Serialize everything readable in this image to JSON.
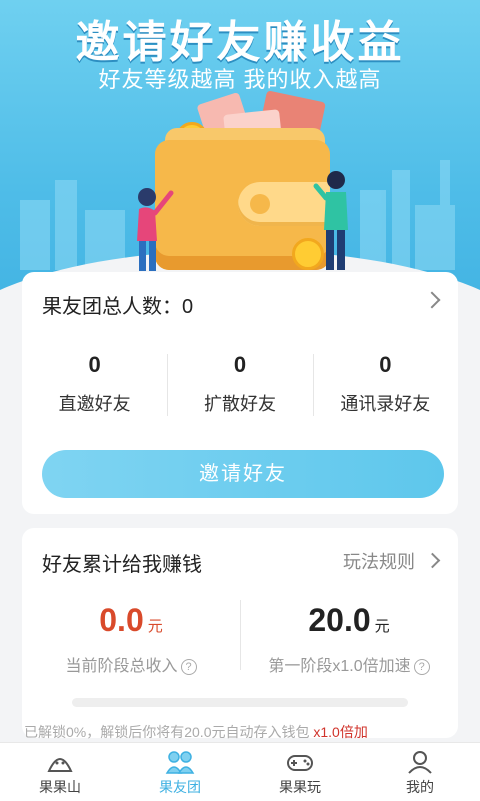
{
  "hero": {
    "title": "邀请好友赚收益",
    "subtitle": "好友等级越高 我的收入越高"
  },
  "team": {
    "total_label": "果友团总人数：",
    "total_count": "0",
    "stats": [
      {
        "value": "0",
        "label": "直邀好友"
      },
      {
        "value": "0",
        "label": "扩散好友"
      },
      {
        "value": "0",
        "label": "通讯录好友"
      }
    ],
    "invite_button": "邀请好友"
  },
  "earnings": {
    "title": "好友累计给我赚钱",
    "rules_link": "玩法规则",
    "current_income": {
      "value": "0.0",
      "unit": "元",
      "label": "当前阶段总收入",
      "color": "#d94a2b"
    },
    "stage_speed": {
      "value": "20.0",
      "unit": "元",
      "label": "第一阶段x1.0倍加速",
      "color": "#222222"
    },
    "help_icon_text": "?",
    "progress": 0,
    "unlock_text": "已解锁0%，解锁后你将有20.0元自动存入钱包",
    "unlock_highlight": "x1.0倍加"
  },
  "tabbar": {
    "tabs": [
      {
        "label": "果果山",
        "icon": "mountain-icon",
        "active": false
      },
      {
        "label": "果友团",
        "icon": "team-icon",
        "active": true
      },
      {
        "label": "果果玩",
        "icon": "gamepad-icon",
        "active": false
      },
      {
        "label": "我的",
        "icon": "profile-icon",
        "active": false
      }
    ]
  },
  "colors": {
    "accent": "#3fb1e2",
    "hero_bg": "#4fbde8",
    "highlight_red": "#d0332b"
  }
}
